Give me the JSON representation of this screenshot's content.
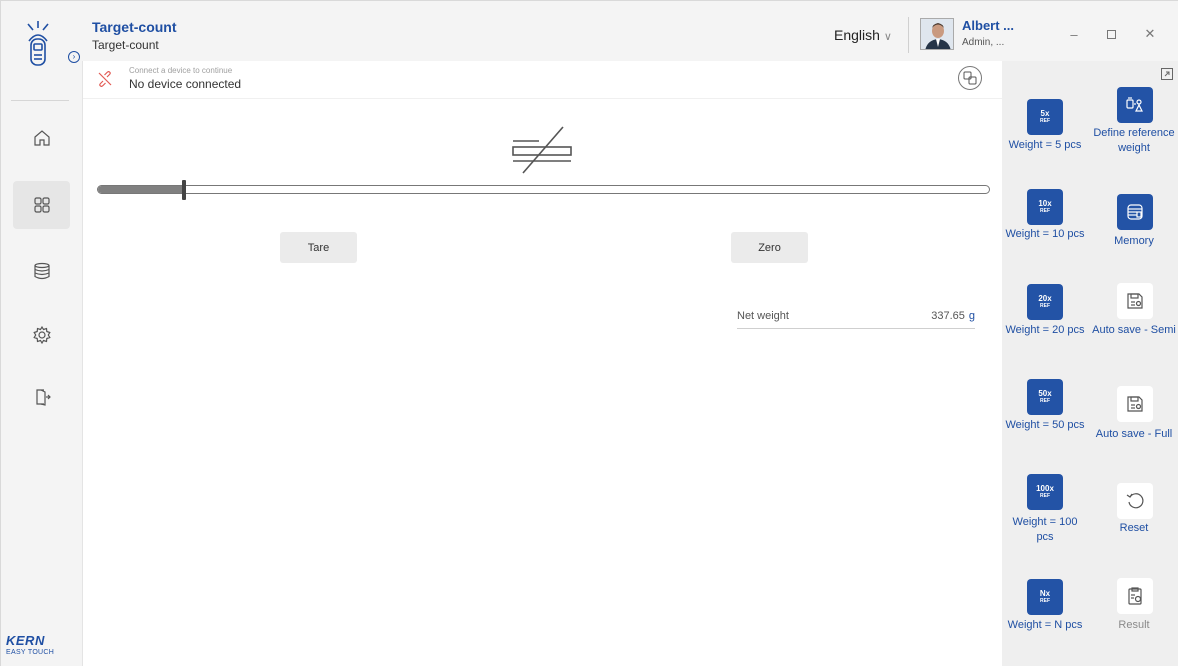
{
  "header": {
    "title": "Target-count",
    "subtitle": "Target-count",
    "language": "English",
    "user_name": "Albert ...",
    "user_role": "Admin, ..."
  },
  "connection": {
    "hint": "Connect a device to continue",
    "status": "No device connected"
  },
  "main": {
    "progress_fraction": 0.097,
    "tare_label": "Tare",
    "zero_label": "Zero",
    "net_weight_label": "Net weight",
    "net_weight_value": "337.65",
    "net_weight_unit": "g"
  },
  "panel": {
    "ref_buttons": [
      {
        "big": "5x",
        "small": "REF",
        "label": "Weight = 5 pcs"
      },
      {
        "big": "10x",
        "small": "REF",
        "label": "Weight = 10 pcs"
      },
      {
        "big": "20x",
        "small": "REF",
        "label": "Weight = 20 pcs"
      },
      {
        "big": "50x",
        "small": "REF",
        "label": "Weight = 50 pcs"
      },
      {
        "big": "100x",
        "small": "REF",
        "label": "Weight = 100 pcs"
      },
      {
        "big": "Nx",
        "small": "REF",
        "label": "Weight = N pcs"
      }
    ],
    "actions": [
      {
        "label": "Define reference weight",
        "icon": "reference-weight-icon"
      },
      {
        "label": "Memory",
        "icon": "memory-icon"
      },
      {
        "label": "Auto save - Semi",
        "icon": "auto-save-icon"
      },
      {
        "label": "Auto save - Full",
        "icon": "auto-save-icon"
      },
      {
        "label": "Reset",
        "icon": "reset-icon"
      },
      {
        "label": "Result",
        "icon": "result-icon"
      }
    ]
  },
  "brand": {
    "logo": "KERN",
    "tagline": "EASY TOUCH"
  },
  "colors": {
    "accent": "#1f4fa3",
    "button_blue": "#2353a6",
    "panel_bg": "#efefef"
  }
}
